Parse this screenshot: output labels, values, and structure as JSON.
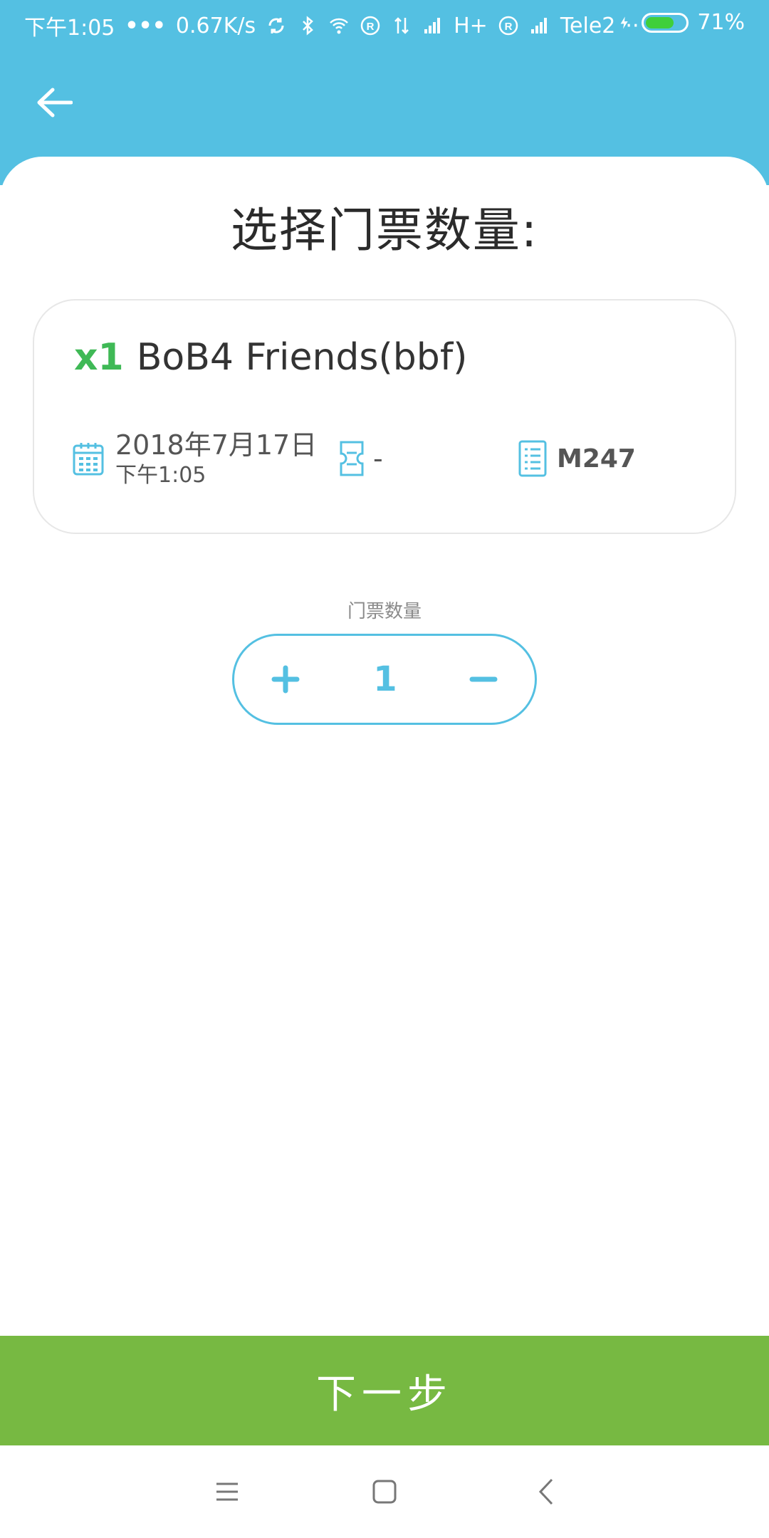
{
  "status_bar": {
    "time": "下午1:05",
    "dots": "•••",
    "speed": "0.67K/s",
    "network_type": "H+",
    "carrier": "Tele2",
    "carrier_dots": "··",
    "battery_percent": "71%",
    "battery_level": 0.71
  },
  "header": {
    "back_icon": "arrow-left-icon"
  },
  "page": {
    "title": "选择门票数量:"
  },
  "ticket": {
    "quantity": "x1",
    "name": "BoB4 Friends(bbf)",
    "date": "2018年7月17日",
    "time": "下午1:05",
    "ticket_value": "-",
    "order_value": "M247"
  },
  "quantity_selector": {
    "label": "门票数量",
    "plus": "+",
    "value": "1",
    "minus": "−"
  },
  "footer": {
    "next_label": "下一步"
  },
  "colors": {
    "header": "#54c0e2",
    "accent": "#54c0e2",
    "quantity_green": "#3fb956",
    "next_button": "#77b942"
  }
}
